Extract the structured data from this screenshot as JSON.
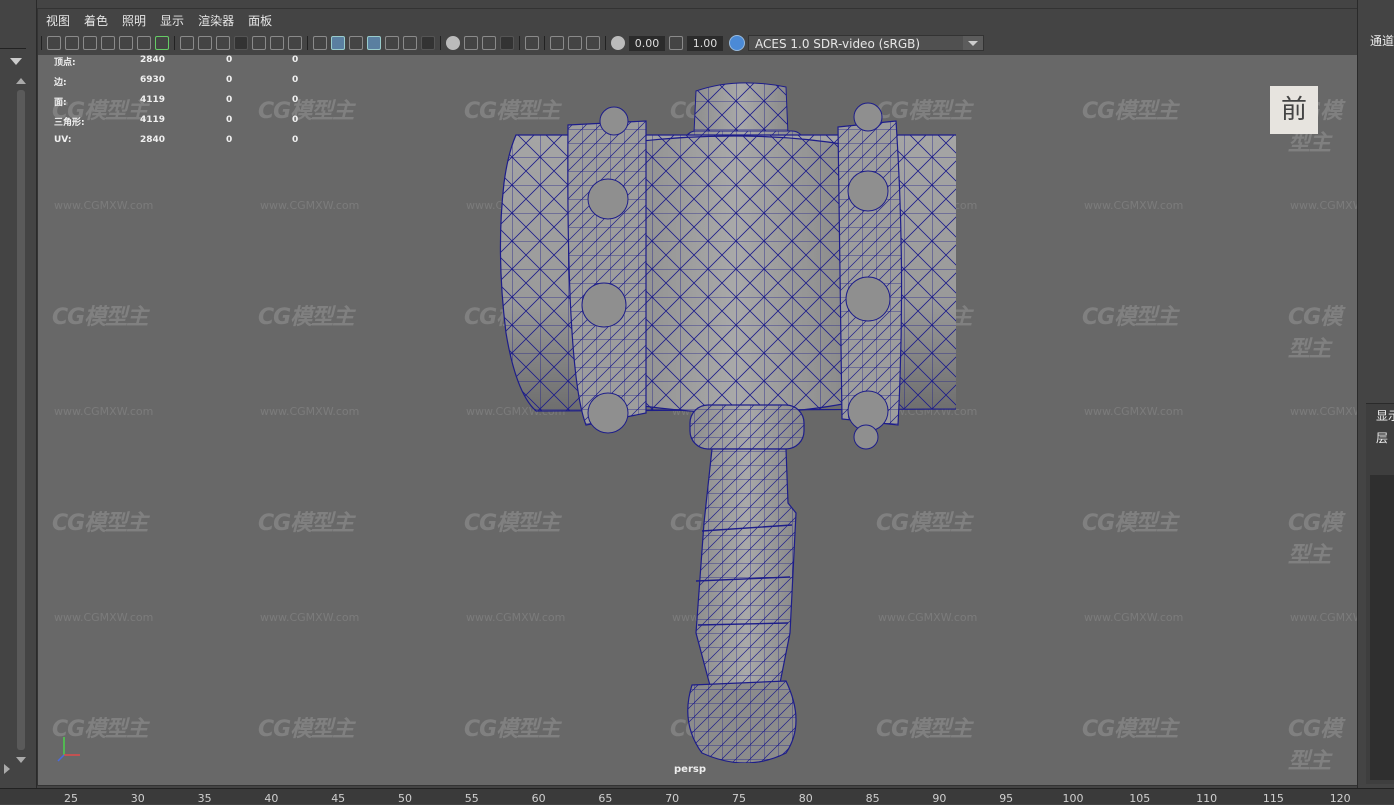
{
  "menu": [
    "视图",
    "着色",
    "照明",
    "显示",
    "渲染器",
    "面板"
  ],
  "toolbar": {
    "exposure": "0.00",
    "gamma": "1.00",
    "color_space": "ACES 1.0 SDR-video (sRGB)"
  },
  "stats": [
    {
      "label": "顶点:",
      "v1": "2840",
      "v2": "0",
      "v3": "0"
    },
    {
      "label": "边:",
      "v1": "6930",
      "v2": "0",
      "v3": "0"
    },
    {
      "label": "面:",
      "v1": "4119",
      "v2": "0",
      "v3": "0"
    },
    {
      "label": "三角形:",
      "v1": "4119",
      "v2": "0",
      "v3": "0"
    },
    {
      "label": "UV:",
      "v1": "2840",
      "v2": "0",
      "v3": "0"
    }
  ],
  "viewcube_label": "前",
  "camera_label": "persp",
  "watermark_text": "CG模型主",
  "watermark_url": "www.CGMXW.com",
  "right_panel": {
    "title": "通道",
    "display_tab": "显示",
    "layer_tab": "层"
  },
  "timeline_ticks": [
    "25",
    "30",
    "35",
    "40",
    "45",
    "50",
    "55",
    "60",
    "65",
    "70",
    "75",
    "80",
    "85",
    "90",
    "95",
    "100",
    "105",
    "110",
    "115",
    "120"
  ]
}
